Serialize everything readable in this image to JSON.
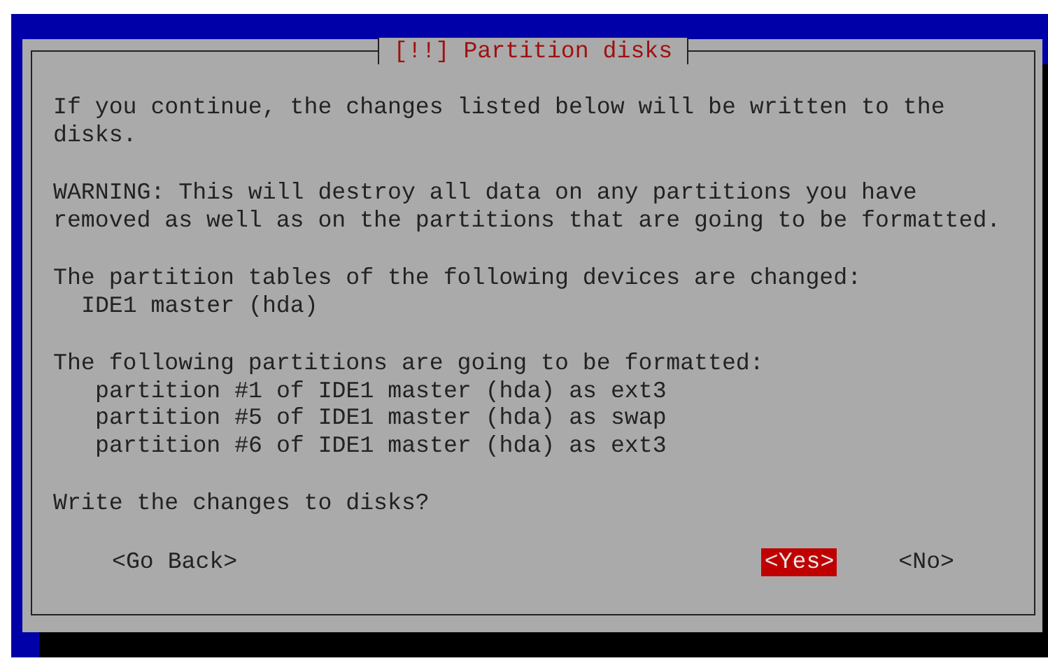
{
  "dialog": {
    "title": "[!!] Partition disks",
    "intro": "If you continue, the changes listed below will be written to the disks.",
    "warning": "WARNING: This will destroy all data on any partitions you have removed as well as on the partitions that are going to be formatted.",
    "sections": [
      {
        "heading": "The partition tables of the following devices are changed:",
        "items": [
          "IDE1 master (hda)"
        ]
      },
      {
        "heading": "The following partitions are going to be formatted:",
        "items": [
          "partition #1 of IDE1 master (hda) as ext3",
          "partition #5 of IDE1 master (hda) as swap",
          "partition #6 of IDE1 master (hda) as ext3"
        ]
      }
    ],
    "question": "Write the changes to disks?",
    "back_button": {
      "label": "<Go Back>",
      "selected": false
    },
    "buttons": [
      {
        "label": "<Yes>",
        "selected": true
      },
      {
        "label": "<No>",
        "selected": false
      }
    ]
  }
}
